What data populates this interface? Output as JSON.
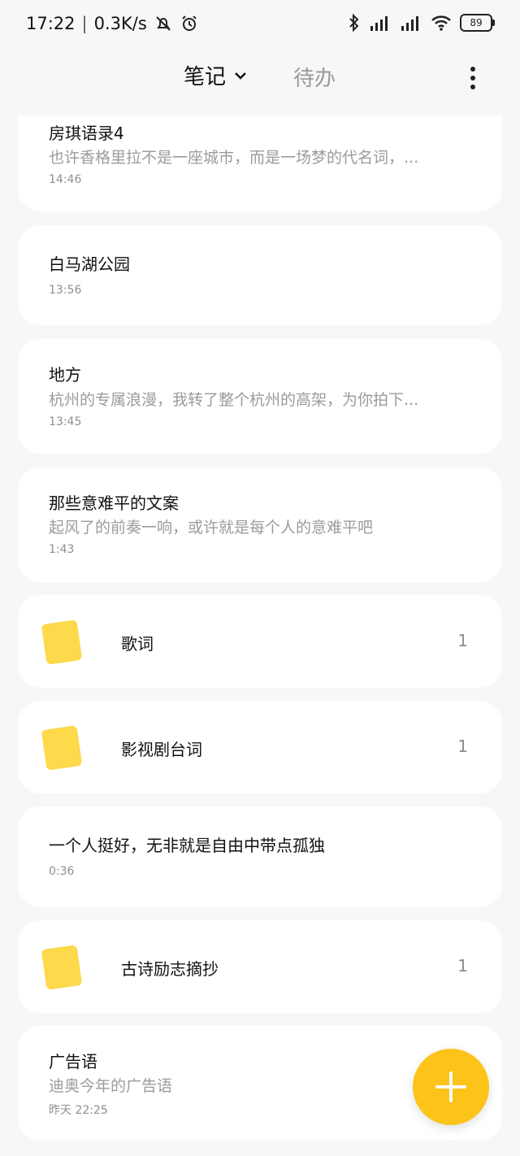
{
  "status_bar": {
    "time": "17:22",
    "net_speed": "0.3K/s",
    "battery": "89"
  },
  "header": {
    "tab_notes": "笔记",
    "tab_todo": "待办"
  },
  "notes": [
    {
      "title": "房琪语录4",
      "snippet": "也许香格里拉不是一座城市，而是一场梦的代名词，...",
      "time": "14:46"
    },
    {
      "title": "白马湖公园",
      "snippet": "",
      "time": "13:56"
    },
    {
      "title": "地方",
      "snippet": "杭州的专属浪漫，我转了整个杭州的高架，为你拍下...",
      "time": "13:45"
    },
    {
      "title": "那些意难平的文案",
      "snippet": "起风了的前奏一响，或许就是每个人的意难平吧",
      "time": "1:43"
    },
    {
      "title": "一个人挺好，无非就是自由中带点孤独",
      "snippet": "",
      "time": "0:36"
    },
    {
      "title": "广告语",
      "snippet": "迪奥今年的广告语",
      "time": "昨天 22:25"
    }
  ],
  "folders": [
    {
      "name": "歌词",
      "count": "1"
    },
    {
      "name": "影视剧台词",
      "count": "1"
    },
    {
      "name": "古诗励志摘抄",
      "count": "1"
    }
  ],
  "colors": {
    "accent": "#fcc319",
    "folder": "#fdd94b",
    "background": "#f7f7f7"
  }
}
